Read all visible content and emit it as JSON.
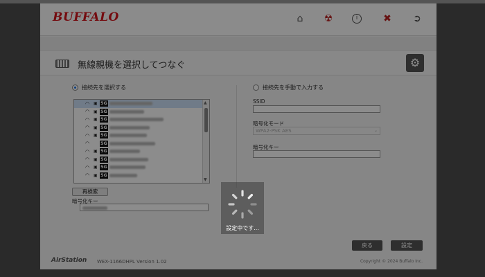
{
  "header": {
    "logo": "BUFFALO",
    "icons": [
      "home-icon",
      "restart-icon",
      "info-icon",
      "power-icon",
      "logout-icon"
    ]
  },
  "titlebar": {
    "title": "無線親機を選択してつなぐ",
    "settings_icon": "gears-icon"
  },
  "left": {
    "radio_label": "接続先を選択する",
    "radio_selected": true,
    "networks": [
      {
        "band": "5G",
        "secure": true,
        "selected": true
      },
      {
        "band": "5G",
        "secure": true,
        "selected": false
      },
      {
        "band": "5G",
        "secure": true,
        "selected": false
      },
      {
        "band": "5G",
        "secure": true,
        "selected": false
      },
      {
        "band": "5G",
        "secure": true,
        "selected": false
      },
      {
        "band": "5G",
        "secure": false,
        "selected": false
      },
      {
        "band": "5G",
        "secure": true,
        "selected": false
      },
      {
        "band": "5G",
        "secure": true,
        "selected": false
      },
      {
        "band": "5G",
        "secure": true,
        "selected": false
      },
      {
        "band": "5G",
        "secure": true,
        "selected": false
      }
    ],
    "rescan_label": "再検索",
    "key_label": "暗号化キー"
  },
  "right": {
    "radio_label": "接続先を手動で入力する",
    "radio_selected": false,
    "ssid_label": "SSID",
    "mode_label": "暗号化モード",
    "mode_value": "WPA2-PSK AES",
    "key_label": "暗号化キー"
  },
  "actions": {
    "back_label": "戻る",
    "apply_label": "設定"
  },
  "footer": {
    "brand": "AirStation",
    "version": "WEX-1166DHPL Version 1.02",
    "copyright": "Copyright © 2024 Buffalo Inc."
  },
  "loading": {
    "text": "設定中です..."
  },
  "colors": {
    "brand_red": "#d4141c",
    "overlay": "#000000",
    "button_dark": "#555555",
    "selection": "#cde0f7"
  }
}
